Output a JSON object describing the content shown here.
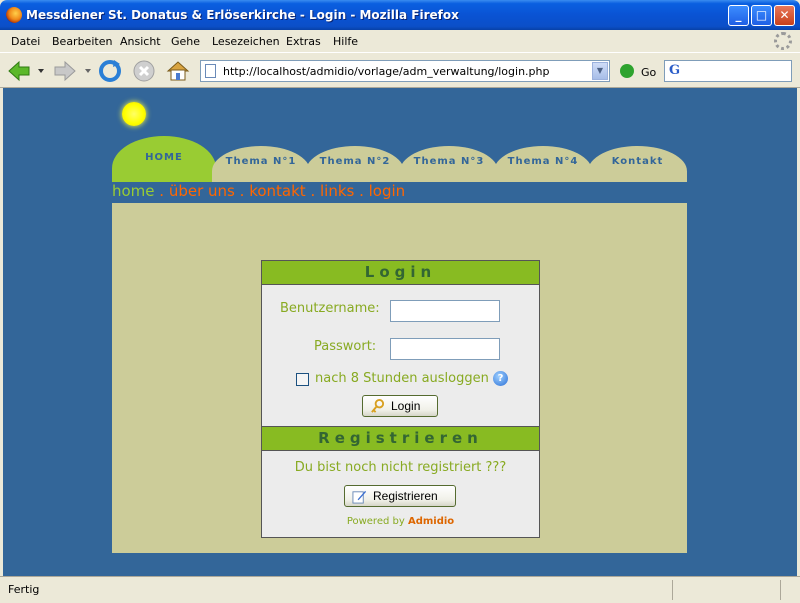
{
  "window": {
    "title": "Messdiener St. Donatus & Erlöserkirche - Login - Mozilla Firefox",
    "buttons": {
      "minimize": "_",
      "maximize": "□",
      "close": "✕"
    }
  },
  "menu": [
    "Datei",
    "Bearbeiten",
    "Ansicht",
    "Gehe",
    "Lesezeichen",
    "Extras",
    "Hilfe"
  ],
  "navbar": {
    "url": "http://localhost/admidio/vorlage/adm_verwaltung/login.php",
    "go_label": "Go",
    "search_logo": "G"
  },
  "tabs": [
    "HOME",
    "Thema N°1",
    "Thema N°2",
    "Thema N°3",
    "Thema N°4",
    "Kontakt"
  ],
  "breadcrumb": {
    "home": "home",
    "items": [
      "über uns",
      "kontakt",
      "links",
      "login"
    ],
    "separator": " . "
  },
  "login": {
    "title": "Login",
    "username_label": "Benutzername:",
    "password_label": "Passwort:",
    "remember_label": "nach 8 Stunden ausloggen",
    "help_glyph": "?",
    "button_label": "Login"
  },
  "register": {
    "title": "Registrieren",
    "text": "Du bist noch nicht registriert ???",
    "button_label": "Registrieren",
    "powered_prefix": "Powered by",
    "powered_brand": "Admidio"
  },
  "status": {
    "text": "Fertig"
  },
  "colors": {
    "page_bg": "#336699",
    "panel_bg": "#cccc99",
    "accent_green": "#99cc33",
    "link_orange": "#ff6600"
  }
}
